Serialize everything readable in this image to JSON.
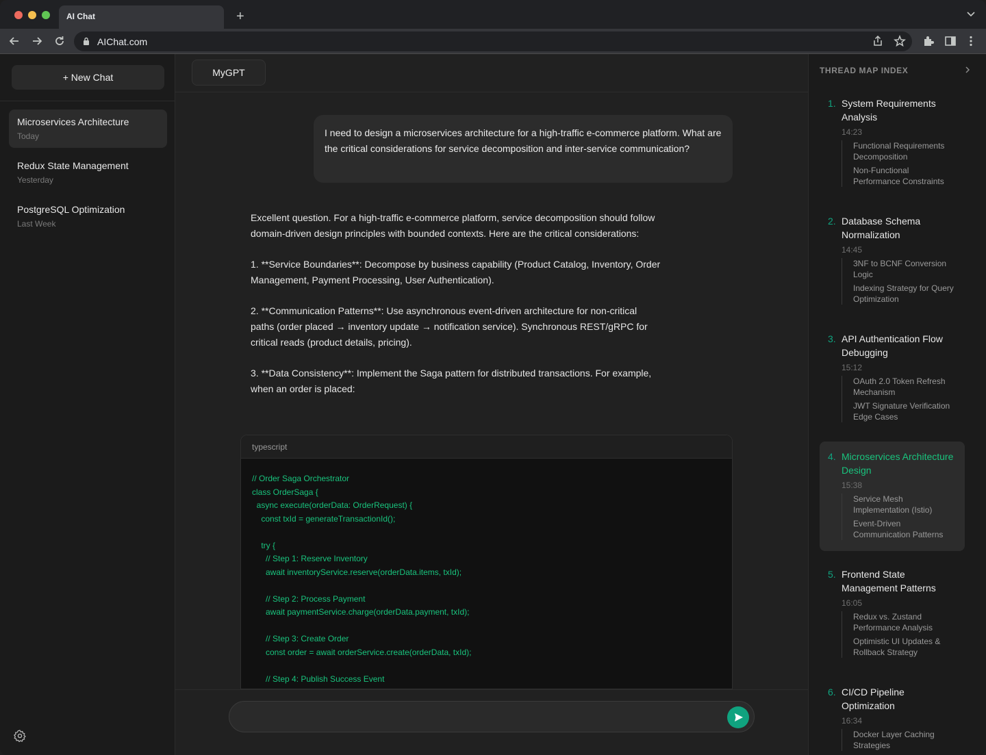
{
  "browser": {
    "tab_title": "AI Chat",
    "url": "AIChat.com"
  },
  "sidebar": {
    "new_chat_label": "+ New Chat",
    "chats": [
      {
        "title": "Microservices Architecture",
        "when": "Today",
        "active": true
      },
      {
        "title": "Redux State Management",
        "when": "Yesterday",
        "active": false
      },
      {
        "title": "PostgreSQL Optimization",
        "when": "Last Week",
        "active": false
      }
    ]
  },
  "main": {
    "model_label": "MyGPT",
    "user_message": "I need to design a microservices architecture for a high-traffic e-commerce platform. What are the critical considerations for service decomposition and inter-service communication?",
    "assistant_paragraphs": [
      "Excellent question. For a high-traffic e-commerce platform, service decomposition should follow domain-driven design principles with bounded contexts. Here are the critical considerations:",
      "1. **Service Boundaries**: Decompose by business capability (Product Catalog, Inventory, Order Management, Payment Processing, User Authentication).",
      "2. **Communication Patterns**: Use asynchronous event-driven architecture for non-critical paths (order placed → inventory update → notification service). Synchronous REST/gRPC for critical reads (product details, pricing).",
      "3. **Data Consistency**: Implement the Saga pattern for distributed transactions. For example, when an order is placed:"
    ],
    "code": {
      "language": "typescript",
      "lines": [
        "// Order Saga Orchestrator",
        "class OrderSaga {",
        "  async execute(orderData: OrderRequest) {",
        "    const txId = generateTransactionId();",
        "",
        "    try {",
        "      // Step 1: Reserve Inventory",
        "      await inventoryService.reserve(orderData.items, txId);",
        "",
        "      // Step 2: Process Payment",
        "      await paymentService.charge(orderData.payment, txId);",
        "",
        "      // Step 3: Create Order",
        "      const order = await orderService.create(orderData, txId);",
        "",
        "      // Step 4: Publish Success Event"
      ]
    },
    "input_placeholder": ""
  },
  "thread_map": {
    "header": "THREAD MAP INDEX",
    "entries": [
      {
        "num": "1.",
        "title": "System Requirements Analysis",
        "time": "14:23",
        "subs": [
          "Functional Requirements Decomposition",
          "Non-Functional Performance Constraints"
        ],
        "active": false
      },
      {
        "num": "2.",
        "title": "Database Schema Normalization",
        "time": "14:45",
        "subs": [
          "3NF to BCNF Conversion Logic",
          "Indexing Strategy for Query Optimization"
        ],
        "active": false
      },
      {
        "num": "3.",
        "title": "API Authentication Flow Debugging",
        "time": "15:12",
        "subs": [
          "OAuth 2.0 Token Refresh Mechanism",
          "JWT Signature Verification Edge Cases"
        ],
        "active": false
      },
      {
        "num": "4.",
        "title": "Microservices Architecture Design",
        "time": "15:38",
        "subs": [
          "Service Mesh Implementation (Istio)",
          "Event-Driven Communication Patterns"
        ],
        "active": true
      },
      {
        "num": "5.",
        "title": "Frontend State Management Patterns",
        "time": "16:05",
        "subs": [
          "Redux vs. Zustand Performance Analysis",
          "Optimistic UI Updates & Rollback Strategy"
        ],
        "active": false
      },
      {
        "num": "6.",
        "title": "CI/CD Pipeline Optimization",
        "time": "16:34",
        "subs": [
          "Docker Layer Caching Strategies"
        ],
        "active": false
      }
    ]
  }
}
